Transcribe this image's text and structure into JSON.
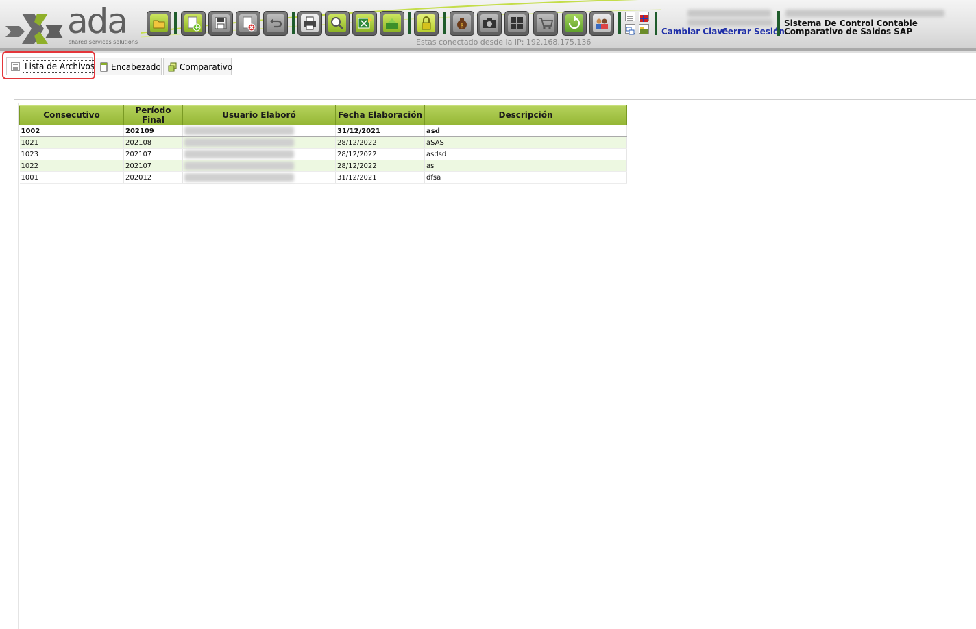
{
  "header": {
    "logo_text": "ada",
    "logo_subtitle": "shared services solutions",
    "ip_notice": "Estas conectado desde la IP: 192.168.175.136",
    "links": {
      "change_password": "Cambiar Clave",
      "logout": "Cerrar Sesión"
    },
    "system_title_line1": "Sistema De Control Contable",
    "system_title_line2": "Comparativo de Saldos SAP",
    "toolbar": [
      {
        "name": "open-folder-icon",
        "style": "green"
      },
      {
        "name": "new-document-icon",
        "style": "green"
      },
      {
        "name": "save-icon",
        "style": "gray"
      },
      {
        "name": "delete-icon",
        "style": "gray"
      },
      {
        "name": "undo-icon",
        "style": "gray"
      },
      {
        "name": "print-icon",
        "style": "gray"
      },
      {
        "name": "search-icon",
        "style": "green"
      },
      {
        "name": "export-excel-icon",
        "style": "green"
      },
      {
        "name": "import-icon",
        "style": "green"
      },
      {
        "name": "lock-icon",
        "style": "green"
      },
      {
        "name": "money-bag-icon",
        "style": "gray"
      },
      {
        "name": "camera-icon",
        "style": "gray"
      },
      {
        "name": "grid-icon",
        "style": "gray"
      },
      {
        "name": "cart-icon",
        "style": "gray"
      },
      {
        "name": "refresh-icon",
        "style": "green"
      },
      {
        "name": "users-icon",
        "style": "gray"
      }
    ],
    "colors": {
      "accent_green": "#94b634",
      "link_blue": "#1f2fa8",
      "separator_green": "#1f5c2c"
    }
  },
  "tabs": [
    {
      "label": "Lista de Archivos",
      "active": true,
      "icon": "list-icon"
    },
    {
      "label": "Encabezado",
      "active": false,
      "icon": "document-icon"
    },
    {
      "label": "Comparativo",
      "active": false,
      "icon": "compare-icon"
    }
  ],
  "grid": {
    "columns": [
      "Consecutivo",
      "Período Final",
      "Usuario Elaboró",
      "Fecha Elaboración",
      "Descripción"
    ],
    "rows": [
      {
        "consecutivo": "1002",
        "periodo": "202109",
        "fecha": "31/12/2021",
        "descripcion": "asd"
      },
      {
        "consecutivo": "1021",
        "periodo": "202108",
        "fecha": "28/12/2022",
        "descripcion": "aSAS"
      },
      {
        "consecutivo": "1023",
        "periodo": "202107",
        "fecha": "28/12/2022",
        "descripcion": "asdsd"
      },
      {
        "consecutivo": "1022",
        "periodo": "202107",
        "fecha": "28/12/2022",
        "descripcion": "as"
      },
      {
        "consecutivo": "1001",
        "periodo": "202012",
        "fecha": "31/12/2021",
        "descripcion": "dfsa"
      }
    ]
  }
}
